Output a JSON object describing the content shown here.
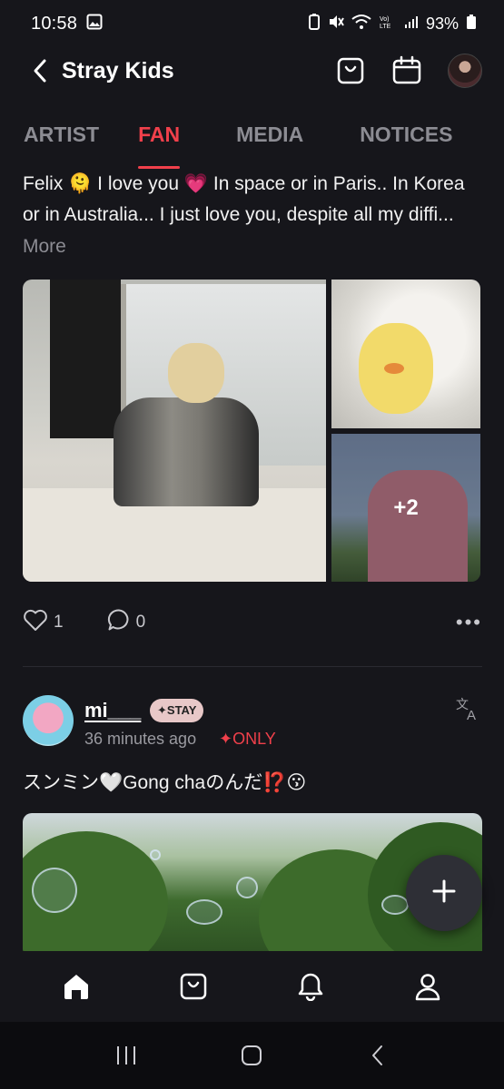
{
  "status_bar": {
    "time": "10:58",
    "battery": "93%",
    "icons": [
      "gallery-icon",
      "battery-saver-icon",
      "mute-icon",
      "wifi-icon",
      "volte-icon",
      "signal-icon",
      "battery-icon"
    ]
  },
  "header": {
    "title": "Stray Kids",
    "icons": [
      "back-icon",
      "shop-icon",
      "calendar-icon",
      "profile-avatar"
    ]
  },
  "tabs": [
    {
      "label": "ARTIST",
      "active": false
    },
    {
      "label": "FAN",
      "active": true
    },
    {
      "label": "MEDIA",
      "active": false
    },
    {
      "label": "NOTICES",
      "active": false
    }
  ],
  "post1": {
    "line1": "Felix 🫠 I love you 💗 In space or in Paris.. In Korea",
    "line2": "or in Australia... I just love you, despite all my diffi...",
    "more_label": "More",
    "extra_images": "+2",
    "likes": "1",
    "comments": "0"
  },
  "post2": {
    "author": "mi___",
    "badge": "✦STAY",
    "time": "36 minutes ago",
    "visibility": "✦ONLY",
    "text": "スンミン🤍Gong chaのんだ⁉️😗"
  },
  "colors": {
    "accent": "#f0404b",
    "background": "#16161b",
    "muted": "#8c8c93"
  },
  "bottom_nav": [
    "home-icon",
    "shop-icon",
    "notifications-icon",
    "profile-icon"
  ],
  "system_nav": [
    "recents-icon",
    "home-button-icon",
    "back-icon"
  ]
}
